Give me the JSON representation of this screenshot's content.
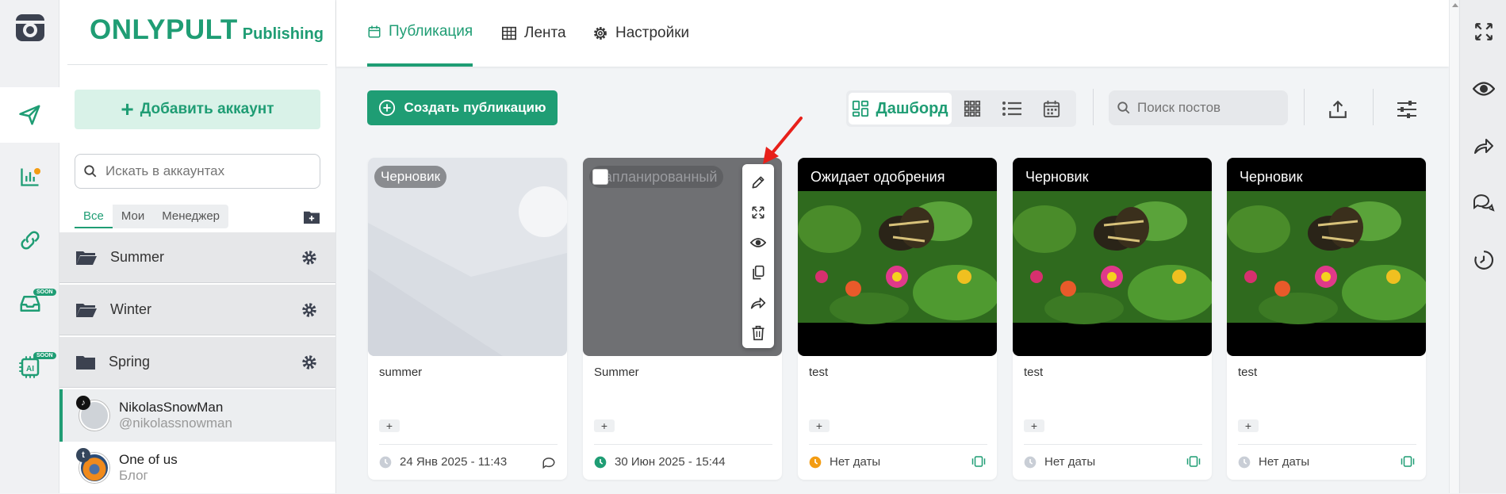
{
  "colors": {
    "accent": "#1f9d74",
    "orange": "#f39c12",
    "draft_badge": "#8a8c90"
  },
  "brand": {
    "main": "ONLYPULT",
    "sub": "Publishing"
  },
  "accounts": {
    "add_label": "Добавить аккаунт",
    "search_placeholder": "Искать в аккаунтах",
    "filters": [
      "Все",
      "Мои",
      "Менеджер"
    ],
    "folders": [
      "Summer",
      "Winter",
      "Spring"
    ],
    "users": [
      {
        "name": "NikolasSnowMan",
        "handle": "@nikolassnowman",
        "network": "tiktok"
      },
      {
        "name": "One of us",
        "handle": "Блог",
        "network": "tumblr"
      }
    ]
  },
  "rail": {
    "soon": "SOON"
  },
  "topbar": {
    "tabs": [
      "Публикация",
      "Лента",
      "Настройки"
    ]
  },
  "toolbar": {
    "create_label": "Создать публикацию",
    "view_dashboard": "Дашборд",
    "search_placeholder": "Поиск постов"
  },
  "cards": [
    {
      "status": "Черновик",
      "title": "summer",
      "date": "24 Янв 2025 - 11:43",
      "plus": "+"
    },
    {
      "status": "Запланированный",
      "title": "Summer",
      "date": "30 Июн 2025 - 15:44",
      "plus": "+"
    },
    {
      "status": "Ожидает одобрения",
      "title": "test",
      "date": "Нет даты",
      "plus": "+"
    },
    {
      "status": "Черновик",
      "title": "test",
      "date": "Нет даты",
      "plus": "+"
    },
    {
      "status": "Черновик",
      "title": "test",
      "date": "Нет даты",
      "plus": "+"
    }
  ]
}
